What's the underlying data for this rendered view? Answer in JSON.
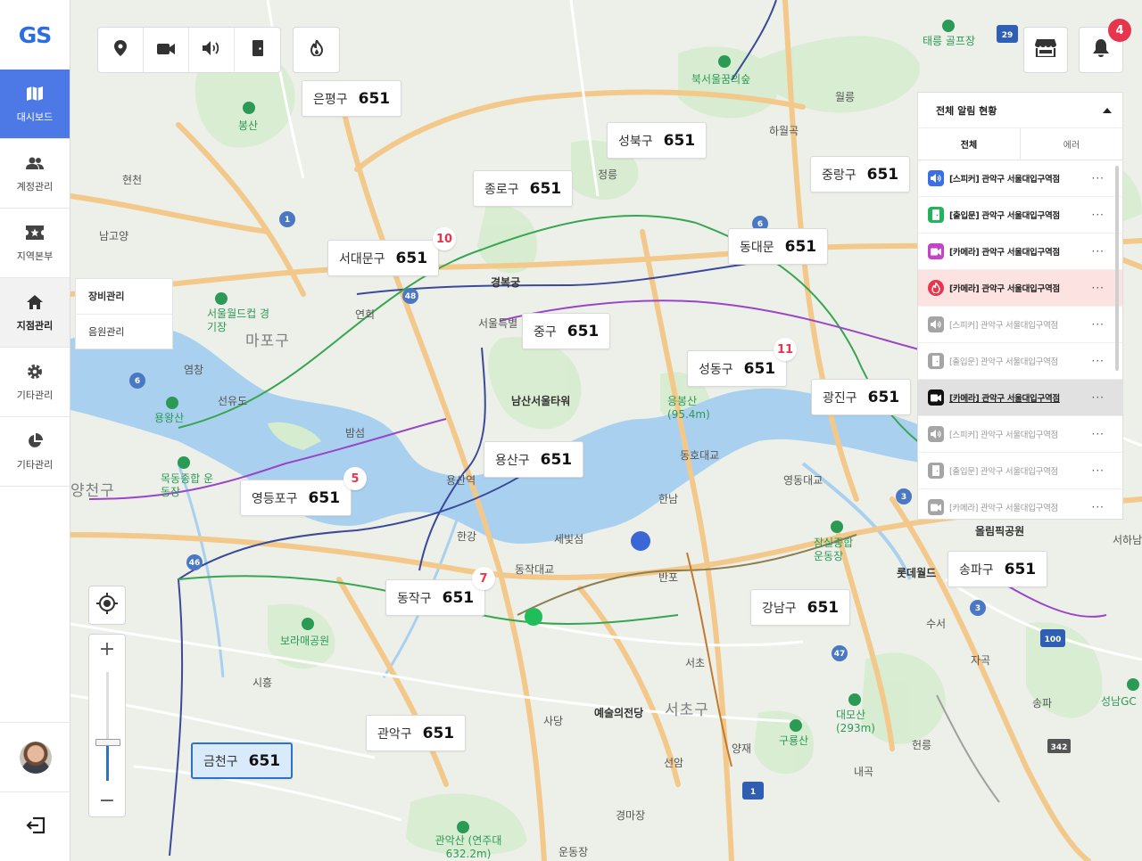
{
  "brand": {
    "logo": "GS"
  },
  "sidebar": {
    "items": [
      {
        "label": "대시보드",
        "icon": "map-icon",
        "active": true
      },
      {
        "label": "계정관리",
        "icon": "users-icon"
      },
      {
        "label": "지역본부",
        "icon": "ticket-icon"
      },
      {
        "label": "지점관리",
        "icon": "home-icon"
      },
      {
        "label": "기타관리",
        "icon": "gear-icon"
      },
      {
        "label": "기타관리",
        "icon": "pie-chart-icon"
      }
    ],
    "submenu": [
      "장비관리",
      "음원관리"
    ]
  },
  "toolbar": {
    "icons": [
      "location-pin-icon",
      "video-camera-icon",
      "speaker-icon",
      "door-icon",
      "fire-icon"
    ]
  },
  "topright": {
    "store_icon": "store-icon",
    "bell_icon": "bell-icon",
    "notifications": "4"
  },
  "alarm_panel": {
    "title": "전체 알림 현황",
    "tabs": [
      "전체",
      "에러"
    ],
    "rows": [
      {
        "type": "speaker",
        "text": "[스피커] 관악구 서울대입구역점",
        "state": "active"
      },
      {
        "type": "door",
        "text": "[출입문] 관악구 서울대입구역점",
        "state": "active"
      },
      {
        "type": "camera",
        "text": "[카메라] 관악구 서울대입구역점",
        "state": "active"
      },
      {
        "type": "fire",
        "text": "[카메라] 관악구 서울대입구역점",
        "state": "error"
      },
      {
        "type": "speaker",
        "text": "[스피커] 관악구 서울대입구역점",
        "state": "dim"
      },
      {
        "type": "door",
        "text": "[출입문] 관악구 서울대입구역점",
        "state": "dim"
      },
      {
        "type": "camera",
        "text": "[카메라] 관악구 서울대입구역점",
        "state": "highlight"
      },
      {
        "type": "speaker",
        "text": "[스피커] 관악구 서울대입구역점",
        "state": "dim"
      },
      {
        "type": "door",
        "text": "[출입문] 관악구 서울대입구역점",
        "state": "dim"
      },
      {
        "type": "camera",
        "text": "[카메라] 관악구 서울대입구역점",
        "state": "dim"
      }
    ],
    "more": "···"
  },
  "districts": [
    {
      "name": "은평구",
      "count": "651"
    },
    {
      "name": "성북구",
      "count": "651"
    },
    {
      "name": "종로구",
      "count": "651"
    },
    {
      "name": "중랑구",
      "count": "651"
    },
    {
      "name": "서대문구",
      "count": "651",
      "pin": "10"
    },
    {
      "name": "동대문",
      "count": "651"
    },
    {
      "name": "중구",
      "count": "651"
    },
    {
      "name": "성동구",
      "count": "651",
      "pin": "11"
    },
    {
      "name": "광진구",
      "count": "651"
    },
    {
      "name": "용산구",
      "count": "651"
    },
    {
      "name": "영등포구",
      "count": "651",
      "pin": "5"
    },
    {
      "name": "동작구",
      "count": "651",
      "pin": "7"
    },
    {
      "name": "강남구",
      "count": "651"
    },
    {
      "name": "송파구",
      "count": "651"
    },
    {
      "name": "관악구",
      "count": "651"
    },
    {
      "name": "금천구",
      "count": "651",
      "selected": true
    }
  ],
  "map_labels": [
    "북서울꿈의숲",
    "태릉 골프장",
    "봉산",
    "현천",
    "남고양",
    "정릉",
    "하월곡",
    "월릉",
    "경복궁",
    "서울특별",
    "연희",
    "서울월드컵 경기장",
    "마포구",
    "염창",
    "선유도",
    "용왕산",
    "밤섬",
    "남산서울타워",
    "응봉산 (95.4m)",
    "동호대교",
    "영동대교",
    "한남",
    "목동종합 운동장",
    "양천구",
    "한강",
    "세빛섬",
    "동작대교",
    "잠실종합 운동장",
    "롯데월드",
    "올림픽공원",
    "서하남",
    "반포",
    "보라매공원",
    "수서",
    "자곡",
    "시흥",
    "서초",
    "예술의전당",
    "서초구",
    "대모산 (293m)",
    "구룡산",
    "헌릉",
    "송파",
    "성남GC",
    "사당",
    "양재",
    "선암",
    "내곡",
    "경마장",
    "관악산 (연주대632.2m)",
    "운동장",
    "용산역"
  ],
  "zoom": {
    "plus": "+",
    "minus": "−",
    "level": 0.35
  }
}
